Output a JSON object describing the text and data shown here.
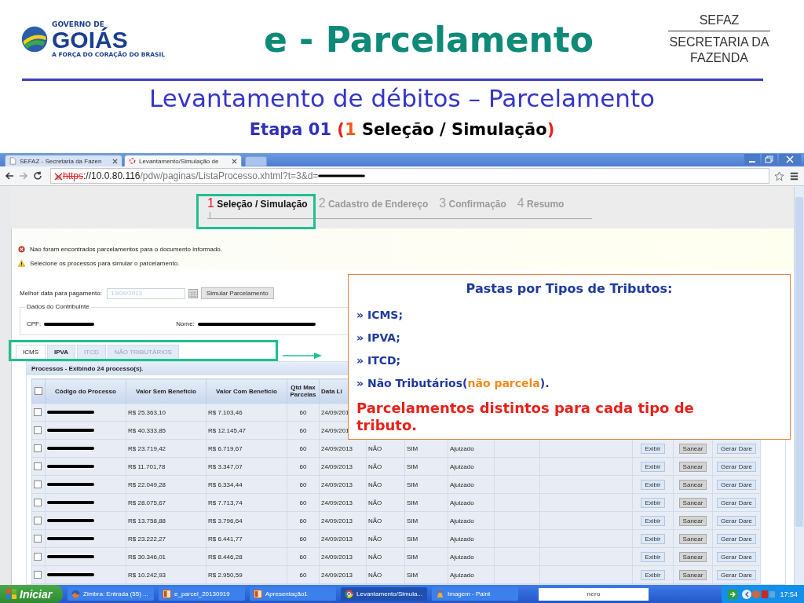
{
  "slide": {
    "logo": {
      "line_1": "GOVERNO DE",
      "line_2": "GOIÁS",
      "tagline": "A FORÇA DO CORAÇÃO DO BRASIL"
    },
    "title": "e - Parcelamento",
    "agency": {
      "short": "SEFAZ",
      "full": "SECRETARIA DA FAZENDA"
    },
    "subtitle": "Levantamento de débitos – Parcelamento",
    "step_heading": [
      {
        "text": "Etapa 01 ",
        "kind": "label"
      },
      {
        "text": "(",
        "kind": "bracket"
      },
      {
        "text": "1",
        "kind": "number"
      },
      {
        "text": " Seleção / Simulação",
        "kind": "name"
      },
      {
        "text": ")",
        "kind": "bracket"
      }
    ]
  },
  "browser": {
    "tabs": [
      {
        "title": "SEFAZ - Secretaria da Fazen",
        "selected": false
      },
      {
        "title": "Levantamento/Simulação de",
        "selected": true
      }
    ],
    "address": {
      "scheme": "https",
      "host": "://10.0.80.116",
      "path": "/pdw/paginas/ListaProcesso.xhtml?t=3&d="
    }
  },
  "steps": [
    {
      "number": "1",
      "label": "Seleção / Simulação",
      "selected": true
    },
    {
      "number": "2",
      "label": "Cadastro de Endereço",
      "selected": false
    },
    {
      "number": "3",
      "label": "Confirmação",
      "selected": false
    },
    {
      "number": "4",
      "label": "Resumo",
      "selected": false
    }
  ],
  "messages": [
    {
      "kind": "error",
      "text": "Nao foram encontrados parcelamentos para o documento informado."
    },
    {
      "kind": "warning",
      "text": "Selecione os processos para simular o parcelamento."
    }
  ],
  "form": {
    "date_label": "Melhor data para pagamento:",
    "date_value": "19/09/2013",
    "button": "Simular Parcelamento"
  },
  "taxpayer": {
    "legend": "Dados do Contribuinte",
    "cpf_label": "CPF:",
    "name_label": "Nome:"
  },
  "tax_tabs": [
    {
      "label": "ICMS",
      "selected": true,
      "disabled": false
    },
    {
      "label": "IPVA",
      "selected": false,
      "disabled": false
    },
    {
      "label": "ITCD",
      "selected": false,
      "disabled": true
    },
    {
      "label": "NÃO TRIBUTÁRIOS",
      "selected": false,
      "disabled": true
    }
  ],
  "processes": {
    "caption": "Processos - Exibindo 24 processo(s).",
    "select_all_checked": false,
    "columns": [
      "Código do Processo",
      "Valor Sem Benefício",
      "Valor Com Benefício",
      "Qtd Max Parcelas",
      "Data Li"
    ],
    "rows": [
      {
        "checked": false,
        "cells": [
          "",
          "R$ 25.363,10",
          "R$ 7.103,46",
          "60",
          "24/09/201"
        ]
      },
      {
        "checked": false,
        "cells": [
          "",
          "R$ 40.333,85",
          "R$ 12.145,47",
          "60",
          "24/09/201"
        ]
      },
      {
        "checked": false,
        "cells": [
          "",
          "R$ 23.719,42",
          "R$ 6.719,67",
          "60",
          "24/09/2013",
          "NÃO",
          "SIM",
          "Ajuizado"
        ],
        "actions": [
          {
            "label": "Exibir",
            "disabled": false
          },
          {
            "label": "Sanear",
            "disabled": true
          },
          {
            "label": "Gerar Dare",
            "disabled": false
          }
        ]
      },
      {
        "checked": false,
        "cells": [
          "",
          "R$ 11.701,78",
          "R$ 3.347,07",
          "60",
          "24/09/2013",
          "NÃO",
          "SIM",
          "Ajuizado"
        ],
        "actions": [
          {
            "label": "Exibir",
            "disabled": false
          },
          {
            "label": "Sanear",
            "disabled": true
          },
          {
            "label": "Gerar Dare",
            "disabled": false
          }
        ]
      },
      {
        "checked": false,
        "cells": [
          "",
          "R$ 22.049,28",
          "R$ 6.334,44",
          "60",
          "24/09/2013",
          "NÃO",
          "SIM",
          "Ajuizado"
        ],
        "actions": [
          {
            "label": "Exibir",
            "disabled": false
          },
          {
            "label": "Sanear",
            "disabled": true
          },
          {
            "label": "Gerar Dare",
            "disabled": false
          }
        ]
      },
      {
        "checked": false,
        "cells": [
          "",
          "R$ 28.075,67",
          "R$ 7.713,74",
          "60",
          "24/09/2013",
          "NÃO",
          "SIM",
          "Ajuizado"
        ],
        "actions": [
          {
            "label": "Exibir",
            "disabled": false
          },
          {
            "label": "Sanear",
            "disabled": true
          },
          {
            "label": "Gerar Dare",
            "disabled": false
          }
        ]
      },
      {
        "checked": false,
        "cells": [
          "",
          "R$ 13.758,88",
          "R$ 3.796,64",
          "60",
          "24/09/2013",
          "NÃO",
          "SIM",
          "Ajuizado"
        ],
        "actions": [
          {
            "label": "Exibir",
            "disabled": false
          },
          {
            "label": "Sanear",
            "disabled": true
          },
          {
            "label": "Gerar Dare",
            "disabled": false
          }
        ]
      },
      {
        "checked": false,
        "cells": [
          "",
          "R$ 23.222,27",
          "R$ 6.441,77",
          "60",
          "24/09/2013",
          "NÃO",
          "SIM",
          "Ajuizado"
        ],
        "actions": [
          {
            "label": "Exibir",
            "disabled": false
          },
          {
            "label": "Sanear",
            "disabled": true
          },
          {
            "label": "Gerar Dare",
            "disabled": false
          }
        ]
      },
      {
        "checked": false,
        "cells": [
          "",
          "R$ 30.346,01",
          "R$ 8.446,28",
          "60",
          "24/09/2013",
          "NÃO",
          "SIM",
          "Ajuizado"
        ],
        "actions": [
          {
            "label": "Exibir",
            "disabled": false
          },
          {
            "label": "Sanear",
            "disabled": true
          },
          {
            "label": "Gerar Dare",
            "disabled": false
          }
        ]
      },
      {
        "checked": false,
        "cells": [
          "",
          "R$ 10.242,93",
          "R$ 2.950,59",
          "60",
          "24/09/2013",
          "NÃO",
          "SIM",
          "Ajuizado"
        ],
        "actions": [
          {
            "label": "Exibir",
            "disabled": false
          },
          {
            "label": "Sanear",
            "disabled": true
          },
          {
            "label": "Gerar Dare",
            "disabled": false
          }
        ]
      }
    ]
  },
  "callout": {
    "title": "Pastas por Tipos de Tributos:",
    "items": [
      [
        {
          "text": "» ICMS;",
          "kind": "plain"
        }
      ],
      [
        {
          "text": "» IPVA;",
          "kind": "plain"
        }
      ],
      [
        {
          "text": "» ITCD;",
          "kind": "plain"
        }
      ],
      [
        {
          "text": "» Não Tributários(",
          "kind": "plain"
        },
        {
          "text": "não parcela",
          "kind": "note"
        },
        {
          "text": ").",
          "kind": "plain"
        }
      ]
    ],
    "note": "Parcelamentos distintos para cada tipo de tributo."
  },
  "taskbar": {
    "start": "Iniciar",
    "items": [
      {
        "label": "Zimbra: Entrada (55) ...",
        "kind": "firefox",
        "selected": false
      },
      {
        "label": "e_parcel_20130919",
        "kind": "slides",
        "selected": false
      },
      {
        "label": "Apresentação1",
        "kind": "slides",
        "selected": false
      },
      {
        "label": "Levantamento/Simula...",
        "kind": "chrome",
        "selected": true
      },
      {
        "label": "Imagem - Paint",
        "kind": "paint",
        "selected": false
      }
    ],
    "search_logo": "nero",
    "clock": "17:54"
  }
}
